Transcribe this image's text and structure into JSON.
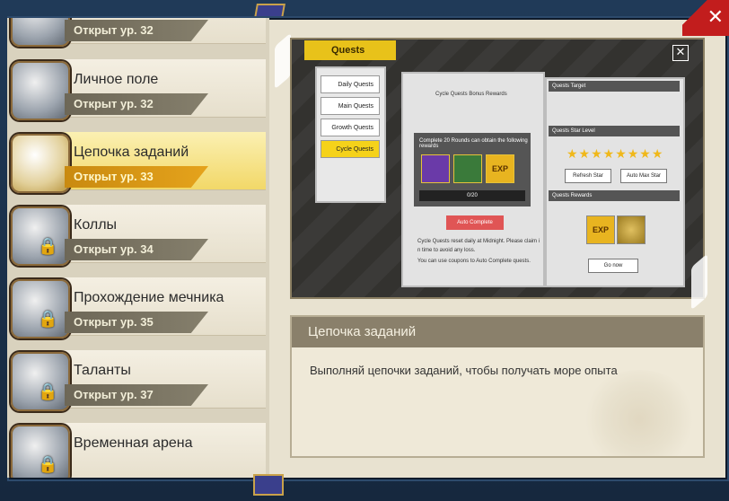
{
  "window": {
    "close_label": "✕"
  },
  "sidebar": {
    "items": [
      {
        "title": "",
        "level": "Открыт ур. 32",
        "icon": "shield-badge-icon"
      },
      {
        "title": "Личное поле",
        "level": "Открыт ур. 32",
        "icon": "winged-shield-icon"
      },
      {
        "title": "Цепочка заданий",
        "level": "Открыт ур. 33",
        "icon": "scroll-icon"
      },
      {
        "title": "Коллы",
        "level": "Открыт ур. 34",
        "icon": "chest-icon"
      },
      {
        "title": "Прохождение мечника",
        "level": "Открыт ур. 35",
        "icon": "armor-icon"
      },
      {
        "title": "Таланты",
        "level": "Открыт ур. 37",
        "icon": "talent-icon"
      },
      {
        "title": "Временная арена",
        "level": "",
        "icon": "arena-icon"
      }
    ]
  },
  "preview": {
    "tab": "Quests",
    "close": "✕",
    "list": [
      "Daily Quests",
      "Main Quests",
      "Growth Quests",
      "Cycle Quests"
    ],
    "mid_title": "Cycle Quests Bonus Rewards",
    "mid_sub": "Complete 20 Rounds can obtain the following rewards",
    "progress": "0/20",
    "auto_complete": "Auto Complete",
    "note1": "Cycle Quests reset daily at Midnight. Please claim i",
    "note2": "n time to avoid any loss.",
    "note3": "You can use coupons to Auto Complete quests.",
    "right_target": "Quests Target",
    "right_star_level": "Quests Star Level",
    "refresh_star": "Refresh Star",
    "auto_max_star": "Auto Max Star",
    "right_rewards": "Quests Rewards",
    "go_now": "Go now",
    "stars": "★★★★★★★★",
    "exp": "EXP"
  },
  "description": {
    "title": "Цепочка заданий",
    "text": "Выполняй цепочки заданий, чтобы получать море опыта"
  }
}
